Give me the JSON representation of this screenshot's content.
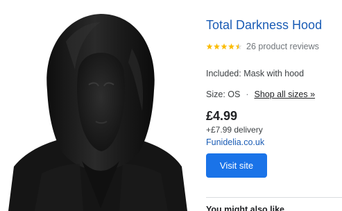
{
  "product": {
    "title": "Total Darkness Hood",
    "rating": 4.5,
    "rating_max": 5,
    "reviews_text": "26 product reviews",
    "included_text": "Included: Mask with hood",
    "size_text": "Size: OS",
    "separator": "·",
    "shop_all_sizes": "Shop all sizes »",
    "price": "£4.99",
    "delivery": "+£7.99 delivery",
    "merchant": "Funidelia.co.uk",
    "visit_button": "Visit site",
    "image_icon": "black-hood-costume-image"
  },
  "section": {
    "you_might_also_like": "You might also like"
  },
  "colors": {
    "title_link": "#1a5cb5",
    "star": "#fbbc04",
    "button": "#1a73e8"
  }
}
